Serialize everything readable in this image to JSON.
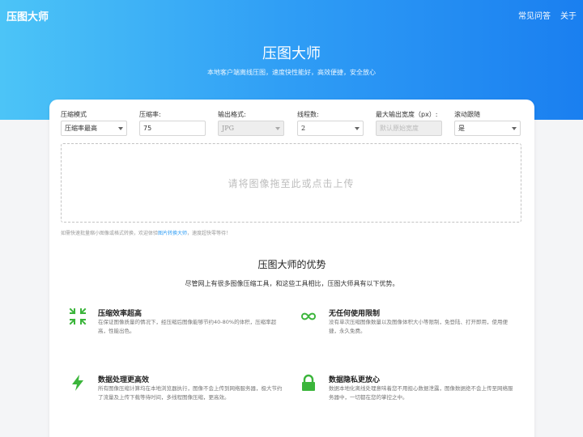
{
  "header": {
    "logo": "压图大师",
    "nav": [
      "常见问答",
      "关于"
    ]
  },
  "hero": {
    "title": "压图大师",
    "subtitle": "本地客户端离线压图，速度快性能好，高效便捷，安全放心"
  },
  "options": {
    "mode": {
      "label": "压缩模式",
      "value": "压缩率最高"
    },
    "ratio": {
      "label": "压缩率:",
      "value": "75"
    },
    "format": {
      "label": "输出格式:",
      "value": "JPG"
    },
    "threads": {
      "label": "线程数:",
      "value": "2"
    },
    "maxwidth": {
      "label": "最大输出宽度（px）:",
      "placeholder": "默认原始宽度"
    },
    "follow": {
      "label": "滚动跟随",
      "value": "是"
    }
  },
  "dropzone": {
    "text": "请将图像拖至此或点击上传"
  },
  "note": {
    "before": "如需快速批量缩小图像或格式转换，欢迎体验",
    "link": "图片转换大师",
    "after": "，速度超快零等待！"
  },
  "advantages": {
    "title": "压图大师的优势",
    "subtitle": "尽管网上有很多图像压缩工具，和这些工具相比，压图大师具有以下优势。",
    "items": [
      {
        "title": "压缩效率超高",
        "desc": "在保证图像质量的情况下，经压缩后图像能够节约40-80%的体积，压缩率超高，性能出色。",
        "icon": "compress-arrows-icon"
      },
      {
        "title": "无任何使用限制",
        "desc": "没有单次压缩图像数量以及图像体积大小等限制，免登陆、打开即用，使用便捷，永久免费。",
        "icon": "infinity-icon"
      },
      {
        "title": "数据处理更高效",
        "desc": "所有图像压缩计算均在本地浏览器执行，图像不会上传到网络服务器，极大节约了流量及上传下载等待时间，多线程图像压缩，更高效。",
        "icon": "lightning-icon"
      },
      {
        "title": "数据隐私更放心",
        "desc": "数据本地化离线处理意味着您不用担心数据泄露，图像数据绝不会上传至网络服务器中，一切都在您的掌控之中。",
        "icon": "lock-icon"
      }
    ]
  },
  "colors": {
    "accent": "#2f9df5",
    "icon_green": "#3bb53b"
  }
}
